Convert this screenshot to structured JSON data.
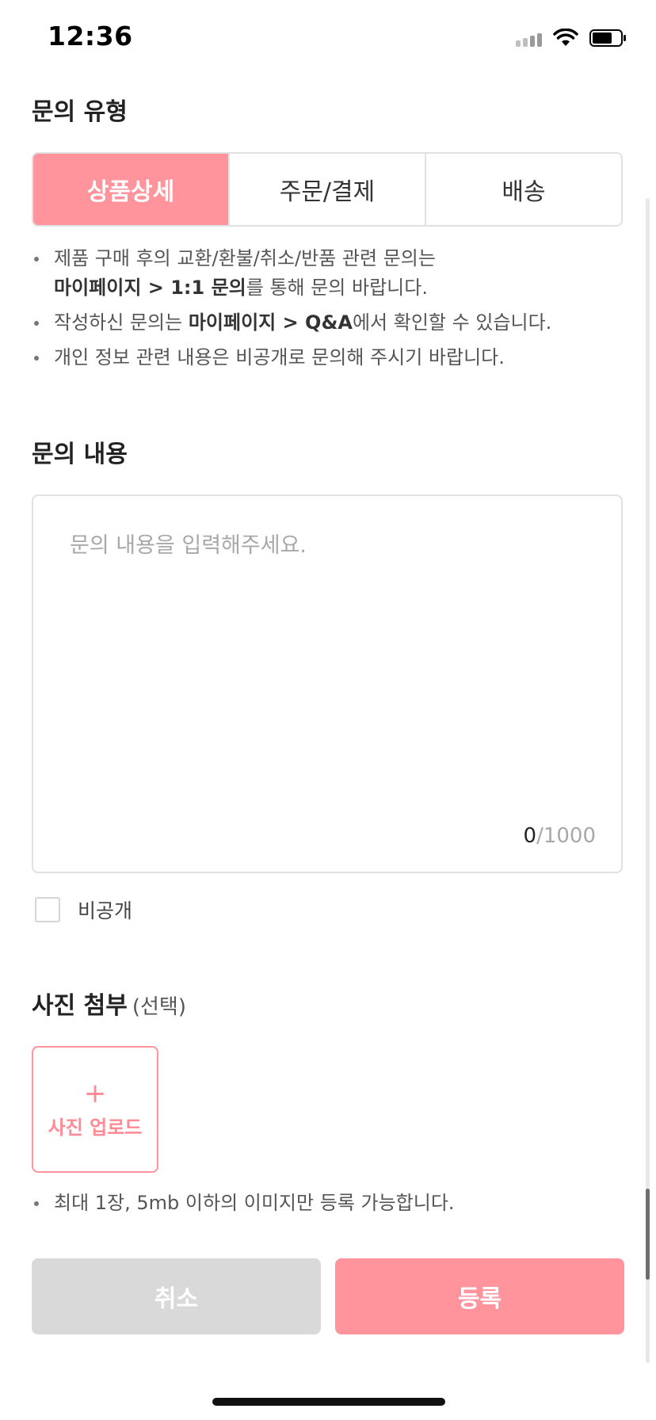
{
  "status_bar": {
    "time": "12:36"
  },
  "inquiry_type": {
    "title": "문의 유형",
    "tabs": [
      {
        "label": "상품상세",
        "active": true
      },
      {
        "label": "주문/결제",
        "active": false
      },
      {
        "label": "배송",
        "active": false
      }
    ],
    "notes": [
      {
        "text_1": "제품 구매 후의 교환/환불/취소/반품 관련 문의는",
        "bold": "마이페이지 > 1:1 문의",
        "text_2": "를 통해 문의 바랍니다."
      },
      {
        "text_1": "작성하신 문의는 ",
        "bold": "마이페이지 > Q&A",
        "text_2": "에서 확인할 수 있습니다."
      },
      {
        "text_1": "개인 정보 관련 내용은 비공개로 문의해 주시기 바랍니다."
      }
    ]
  },
  "inquiry_content": {
    "title": "문의 내용",
    "placeholder": "문의 내용을 입력해주세요.",
    "value": "",
    "char_count": "0",
    "char_max": "/1000",
    "private_label": "비공개"
  },
  "photo": {
    "title": "사진 첨부",
    "optional": "(선택)",
    "plus": "+",
    "upload_label": "사진 업로드",
    "note": "최대 1장, 5mb 이하의 이미지만 등록 가능합니다."
  },
  "actions": {
    "cancel": "취소",
    "submit": "등록"
  },
  "colors": {
    "accent": "#ff949c",
    "disabled": "#d9d9d9"
  },
  "icons": [
    "signal-icon",
    "wifi-icon",
    "battery-icon",
    "plus-icon",
    "checkbox-icon"
  ]
}
